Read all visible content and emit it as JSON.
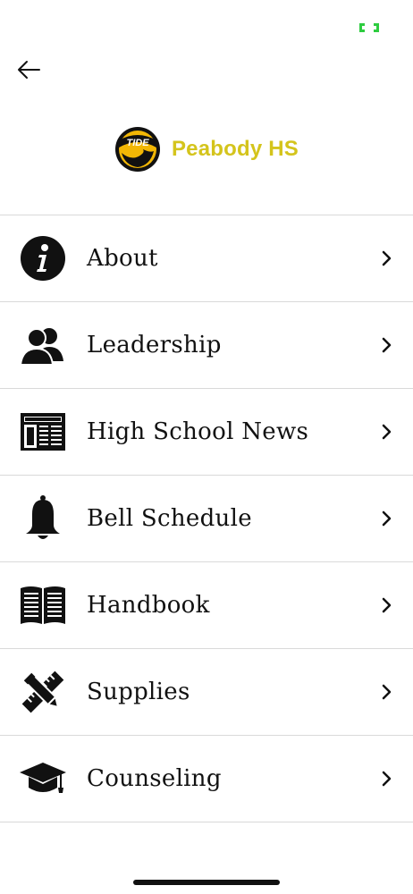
{
  "header": {
    "school_name": "Peabody HS",
    "logo_text": "TIDE",
    "brand_color": "#d4c41c",
    "logo_color": "#f2b705"
  },
  "status": {
    "indicator_color": "#2ecc40"
  },
  "menu": {
    "items": [
      {
        "label": "About",
        "icon": "info-icon"
      },
      {
        "label": "Leadership",
        "icon": "people-icon"
      },
      {
        "label": "High School News",
        "icon": "newspaper-icon"
      },
      {
        "label": "Bell Schedule",
        "icon": "bell-icon"
      },
      {
        "label": "Handbook",
        "icon": "book-icon"
      },
      {
        "label": "Supplies",
        "icon": "pencil-ruler-icon"
      },
      {
        "label": "Counseling",
        "icon": "graduation-cap-icon"
      }
    ]
  }
}
